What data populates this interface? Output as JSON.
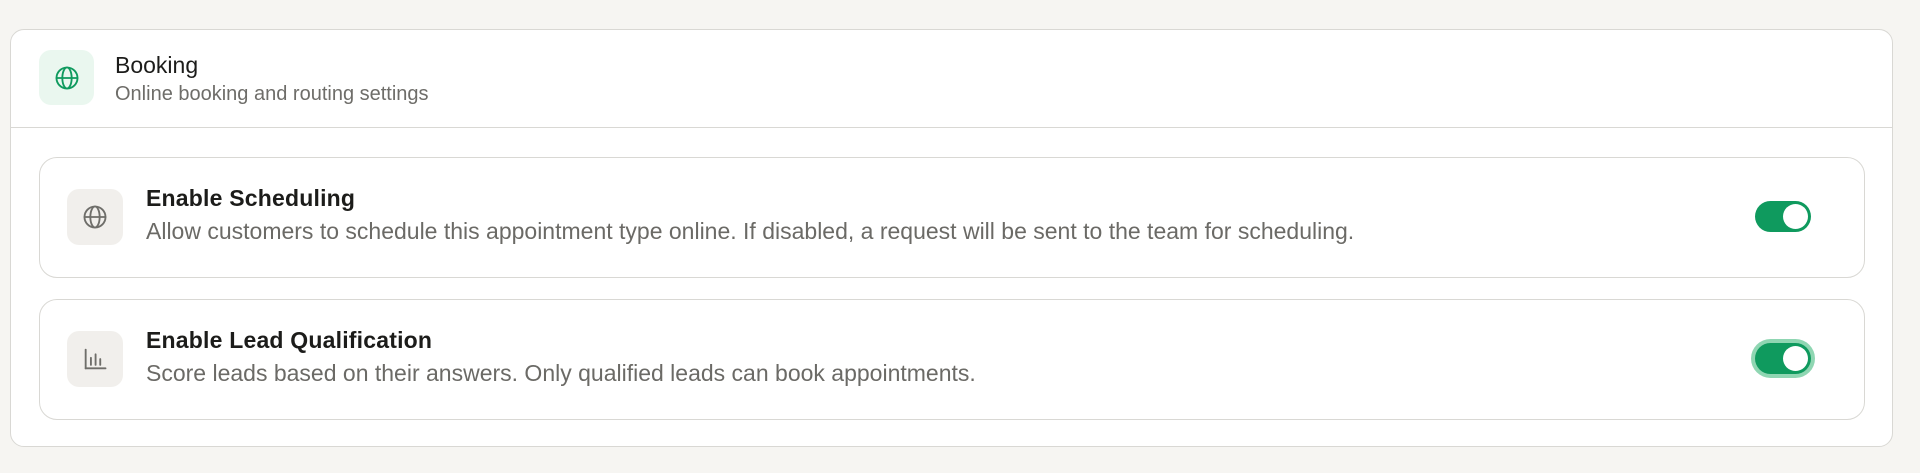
{
  "section": {
    "icon": "globe-icon",
    "title": "Booking",
    "subtitle": "Online booking and routing settings",
    "accent_color": "#0f9a5e"
  },
  "settings": [
    {
      "icon": "globe-icon",
      "title": "Enable Scheduling",
      "description": "Allow customers to schedule this appointment type online. If disabled, a request will be sent to the team for scheduling.",
      "enabled": true,
      "focused": false
    },
    {
      "icon": "bar-chart-icon",
      "title": "Enable Lead Qualification",
      "description": "Score leads based on their answers. Only qualified leads can book appointments.",
      "enabled": true,
      "focused": true
    }
  ]
}
